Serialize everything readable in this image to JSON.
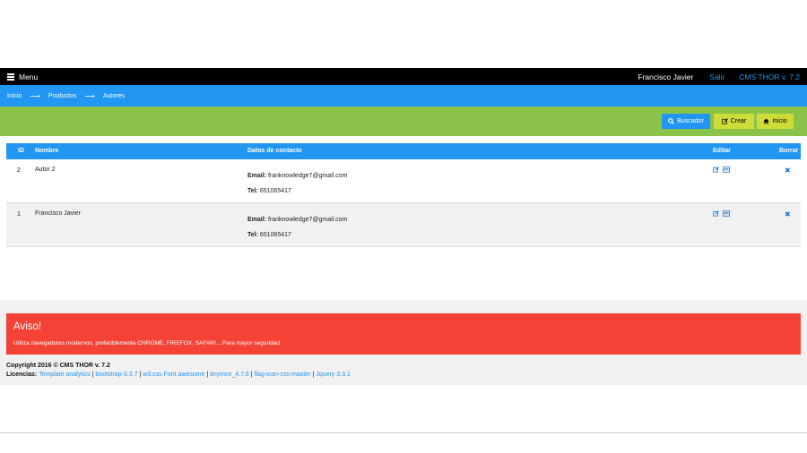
{
  "topbar": {
    "menu_label": "Menu",
    "user_name": "Francisco Javier",
    "logout_label": "Salir",
    "version_label": "CMS THOR v. 7.2"
  },
  "breadcrumb": {
    "items": [
      "Inicio",
      "Productos",
      "Autores"
    ],
    "separator": "⟶"
  },
  "actions": {
    "search_label": "Buscador",
    "create_label": "Crear",
    "home_label": "Inicio"
  },
  "table": {
    "headers": {
      "id": "ID",
      "name": "Nombre",
      "contact": "Datos de contacto",
      "edit": "Editar",
      "delete": "Borrar"
    },
    "email_label": "Email:",
    "tel_label": "Tel:",
    "rows": [
      {
        "id": "2",
        "name": "Autor 2",
        "email": "franknowledge7@gmail.com",
        "tel": "651065417"
      },
      {
        "id": "1",
        "name": "Francisco Javier",
        "email": "franknowledge7@gmail.com",
        "tel": "651065417"
      }
    ],
    "delete_glyph": "✖"
  },
  "footer": {
    "alert_title": "Aviso!",
    "alert_text": "Utiliza navegadores modernos, preferiblemente CHROME, FIREFOX, SAFARI... Para mayor seguridad",
    "copyright": "Copyright 2016 © CMS THOR v. 7.2",
    "licenses_label": "Licencias:",
    "licenses": [
      "Template analytics",
      "bootstrap-3.3.7",
      "w3.css Font awesome",
      "tinymce_4.7.6",
      "flag-icon-css-master",
      "Jquery 3.3.1"
    ]
  },
  "colors": {
    "primary": "#2196f3",
    "green": "#8bc34a",
    "lime": "#cddc39",
    "red": "#f44336",
    "black": "#000000"
  },
  "icons": {
    "menu": "bars-icon",
    "search": "search-icon",
    "create": "edit-icon",
    "home": "home-icon",
    "edit": "edit-icon",
    "view": "id-card-icon",
    "delete": "close-icon"
  }
}
